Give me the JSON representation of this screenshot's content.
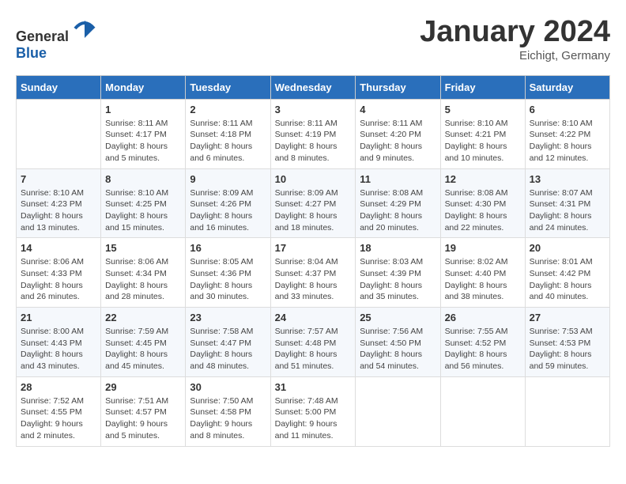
{
  "logo": {
    "text_general": "General",
    "text_blue": "Blue"
  },
  "title": "January 2024",
  "location": "Eichigt, Germany",
  "days_header": [
    "Sunday",
    "Monday",
    "Tuesday",
    "Wednesday",
    "Thursday",
    "Friday",
    "Saturday"
  ],
  "weeks": [
    [
      {
        "day": "",
        "sunrise": "",
        "sunset": "",
        "daylight": ""
      },
      {
        "day": "1",
        "sunrise": "Sunrise: 8:11 AM",
        "sunset": "Sunset: 4:17 PM",
        "daylight": "Daylight: 8 hours and 5 minutes."
      },
      {
        "day": "2",
        "sunrise": "Sunrise: 8:11 AM",
        "sunset": "Sunset: 4:18 PM",
        "daylight": "Daylight: 8 hours and 6 minutes."
      },
      {
        "day": "3",
        "sunrise": "Sunrise: 8:11 AM",
        "sunset": "Sunset: 4:19 PM",
        "daylight": "Daylight: 8 hours and 8 minutes."
      },
      {
        "day": "4",
        "sunrise": "Sunrise: 8:11 AM",
        "sunset": "Sunset: 4:20 PM",
        "daylight": "Daylight: 8 hours and 9 minutes."
      },
      {
        "day": "5",
        "sunrise": "Sunrise: 8:10 AM",
        "sunset": "Sunset: 4:21 PM",
        "daylight": "Daylight: 8 hours and 10 minutes."
      },
      {
        "day": "6",
        "sunrise": "Sunrise: 8:10 AM",
        "sunset": "Sunset: 4:22 PM",
        "daylight": "Daylight: 8 hours and 12 minutes."
      }
    ],
    [
      {
        "day": "7",
        "sunrise": "Sunrise: 8:10 AM",
        "sunset": "Sunset: 4:23 PM",
        "daylight": "Daylight: 8 hours and 13 minutes."
      },
      {
        "day": "8",
        "sunrise": "Sunrise: 8:10 AM",
        "sunset": "Sunset: 4:25 PM",
        "daylight": "Daylight: 8 hours and 15 minutes."
      },
      {
        "day": "9",
        "sunrise": "Sunrise: 8:09 AM",
        "sunset": "Sunset: 4:26 PM",
        "daylight": "Daylight: 8 hours and 16 minutes."
      },
      {
        "day": "10",
        "sunrise": "Sunrise: 8:09 AM",
        "sunset": "Sunset: 4:27 PM",
        "daylight": "Daylight: 8 hours and 18 minutes."
      },
      {
        "day": "11",
        "sunrise": "Sunrise: 8:08 AM",
        "sunset": "Sunset: 4:29 PM",
        "daylight": "Daylight: 8 hours and 20 minutes."
      },
      {
        "day": "12",
        "sunrise": "Sunrise: 8:08 AM",
        "sunset": "Sunset: 4:30 PM",
        "daylight": "Daylight: 8 hours and 22 minutes."
      },
      {
        "day": "13",
        "sunrise": "Sunrise: 8:07 AM",
        "sunset": "Sunset: 4:31 PM",
        "daylight": "Daylight: 8 hours and 24 minutes."
      }
    ],
    [
      {
        "day": "14",
        "sunrise": "Sunrise: 8:06 AM",
        "sunset": "Sunset: 4:33 PM",
        "daylight": "Daylight: 8 hours and 26 minutes."
      },
      {
        "day": "15",
        "sunrise": "Sunrise: 8:06 AM",
        "sunset": "Sunset: 4:34 PM",
        "daylight": "Daylight: 8 hours and 28 minutes."
      },
      {
        "day": "16",
        "sunrise": "Sunrise: 8:05 AM",
        "sunset": "Sunset: 4:36 PM",
        "daylight": "Daylight: 8 hours and 30 minutes."
      },
      {
        "day": "17",
        "sunrise": "Sunrise: 8:04 AM",
        "sunset": "Sunset: 4:37 PM",
        "daylight": "Daylight: 8 hours and 33 minutes."
      },
      {
        "day": "18",
        "sunrise": "Sunrise: 8:03 AM",
        "sunset": "Sunset: 4:39 PM",
        "daylight": "Daylight: 8 hours and 35 minutes."
      },
      {
        "day": "19",
        "sunrise": "Sunrise: 8:02 AM",
        "sunset": "Sunset: 4:40 PM",
        "daylight": "Daylight: 8 hours and 38 minutes."
      },
      {
        "day": "20",
        "sunrise": "Sunrise: 8:01 AM",
        "sunset": "Sunset: 4:42 PM",
        "daylight": "Daylight: 8 hours and 40 minutes."
      }
    ],
    [
      {
        "day": "21",
        "sunrise": "Sunrise: 8:00 AM",
        "sunset": "Sunset: 4:43 PM",
        "daylight": "Daylight: 8 hours and 43 minutes."
      },
      {
        "day": "22",
        "sunrise": "Sunrise: 7:59 AM",
        "sunset": "Sunset: 4:45 PM",
        "daylight": "Daylight: 8 hours and 45 minutes."
      },
      {
        "day": "23",
        "sunrise": "Sunrise: 7:58 AM",
        "sunset": "Sunset: 4:47 PM",
        "daylight": "Daylight: 8 hours and 48 minutes."
      },
      {
        "day": "24",
        "sunrise": "Sunrise: 7:57 AM",
        "sunset": "Sunset: 4:48 PM",
        "daylight": "Daylight: 8 hours and 51 minutes."
      },
      {
        "day": "25",
        "sunrise": "Sunrise: 7:56 AM",
        "sunset": "Sunset: 4:50 PM",
        "daylight": "Daylight: 8 hours and 54 minutes."
      },
      {
        "day": "26",
        "sunrise": "Sunrise: 7:55 AM",
        "sunset": "Sunset: 4:52 PM",
        "daylight": "Daylight: 8 hours and 56 minutes."
      },
      {
        "day": "27",
        "sunrise": "Sunrise: 7:53 AM",
        "sunset": "Sunset: 4:53 PM",
        "daylight": "Daylight: 8 hours and 59 minutes."
      }
    ],
    [
      {
        "day": "28",
        "sunrise": "Sunrise: 7:52 AM",
        "sunset": "Sunset: 4:55 PM",
        "daylight": "Daylight: 9 hours and 2 minutes."
      },
      {
        "day": "29",
        "sunrise": "Sunrise: 7:51 AM",
        "sunset": "Sunset: 4:57 PM",
        "daylight": "Daylight: 9 hours and 5 minutes."
      },
      {
        "day": "30",
        "sunrise": "Sunrise: 7:50 AM",
        "sunset": "Sunset: 4:58 PM",
        "daylight": "Daylight: 9 hours and 8 minutes."
      },
      {
        "day": "31",
        "sunrise": "Sunrise: 7:48 AM",
        "sunset": "Sunset: 5:00 PM",
        "daylight": "Daylight: 9 hours and 11 minutes."
      },
      {
        "day": "",
        "sunrise": "",
        "sunset": "",
        "daylight": ""
      },
      {
        "day": "",
        "sunrise": "",
        "sunset": "",
        "daylight": ""
      },
      {
        "day": "",
        "sunrise": "",
        "sunset": "",
        "daylight": ""
      }
    ]
  ]
}
